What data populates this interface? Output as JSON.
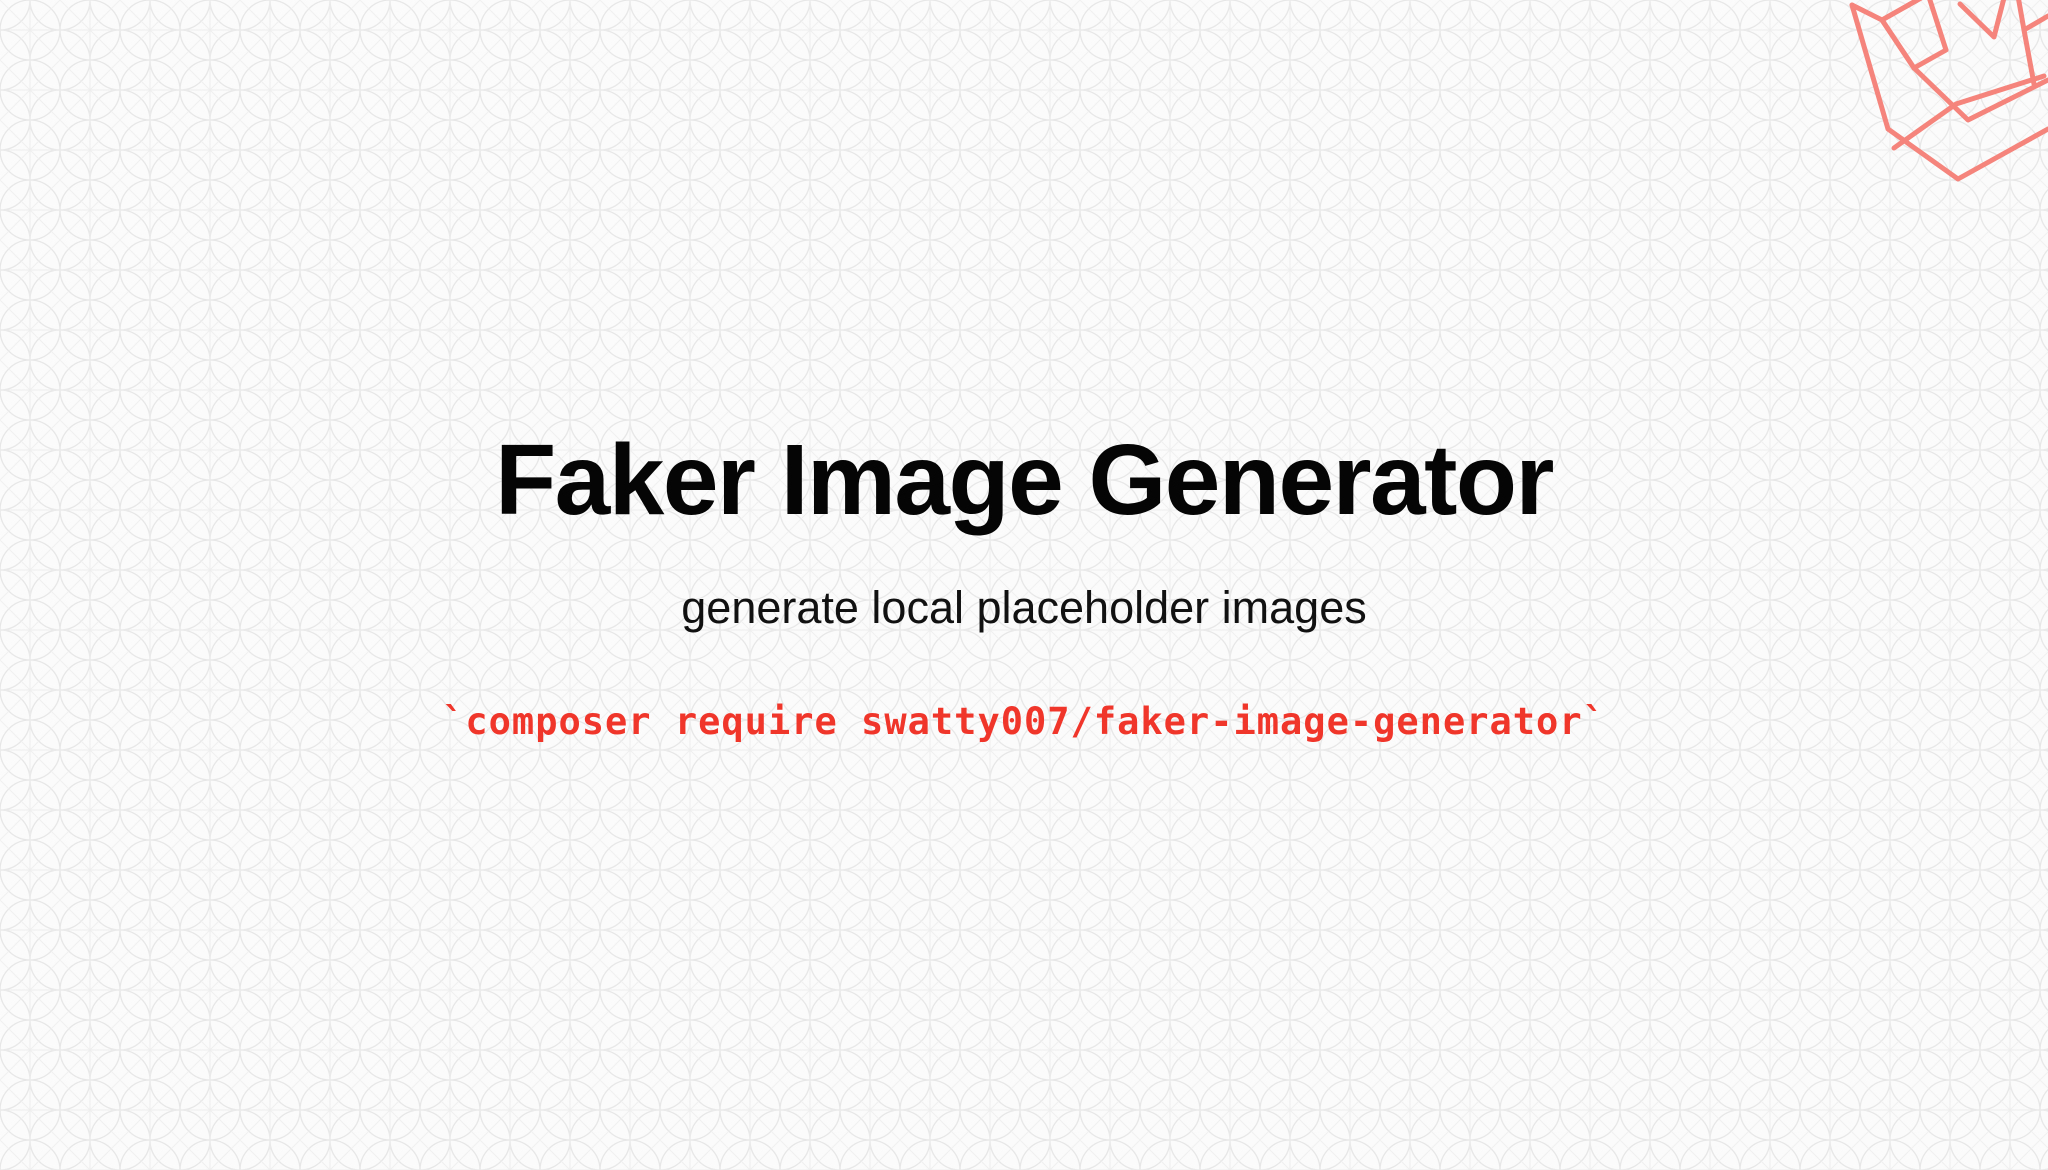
{
  "title": "Faker Image Generator",
  "subtitle": "generate local placeholder images",
  "command": "`composer require swatty007/faker-image-generator`",
  "colors": {
    "background": "#fbfbfb",
    "pattern_line": "#e7e7e7",
    "title": "#050505",
    "subtitle": "#111111",
    "command": "#f0352b",
    "logo_stroke": "#f4847c"
  },
  "icons": {
    "logo": "laravel-logo-icon"
  }
}
